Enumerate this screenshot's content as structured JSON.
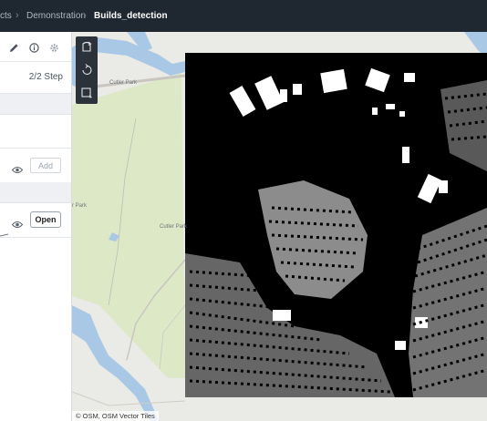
{
  "breadcrumb": {
    "items": [
      "cts",
      "Demonstration",
      "Builds_detection"
    ]
  },
  "panel": {
    "step_text": "2/2 Step",
    "add_label": "Add",
    "open_label": "Open"
  },
  "map": {
    "labels": {
      "cutler_park_1": "Cutler Park",
      "cutler_park_2": "r Park",
      "cutler_park_3": "Cutler Park"
    },
    "attribution": "© OSM, OSM Vector Tiles",
    "colors": {
      "water": "#a9c8e6",
      "park": "#dde8c7",
      "land": "#eaeae6",
      "mask_bg": "#000000",
      "mask_fg": "#ffffff"
    }
  }
}
